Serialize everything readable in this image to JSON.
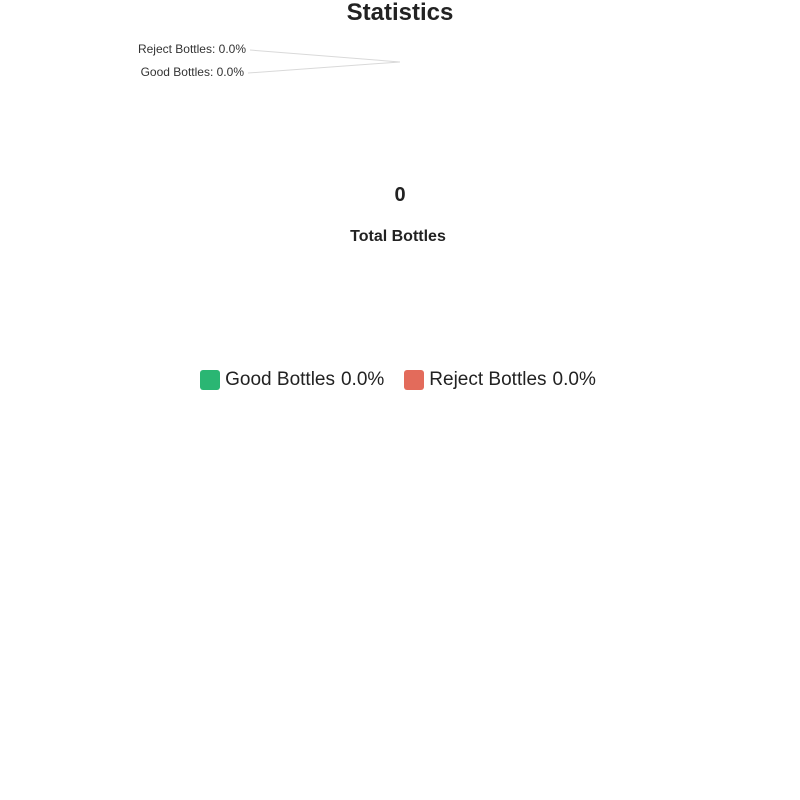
{
  "chart_data": {
    "type": "pie",
    "title": "Statistics",
    "center": {
      "value": "0",
      "label": "Total Bottles"
    },
    "series": [
      {
        "name": "Good Bottles",
        "value": 0,
        "percent_label": "0.0%",
        "callout": "Good Bottles: 0.0%",
        "color": "#2ab673"
      },
      {
        "name": "Reject Bottles",
        "value": 0,
        "percent_label": "0.0%",
        "callout": "Reject Bottles: 0.0%",
        "color": "#e36b5b"
      }
    ],
    "legend_position": "bottom",
    "callout_line_color": "#d9d9d9"
  }
}
